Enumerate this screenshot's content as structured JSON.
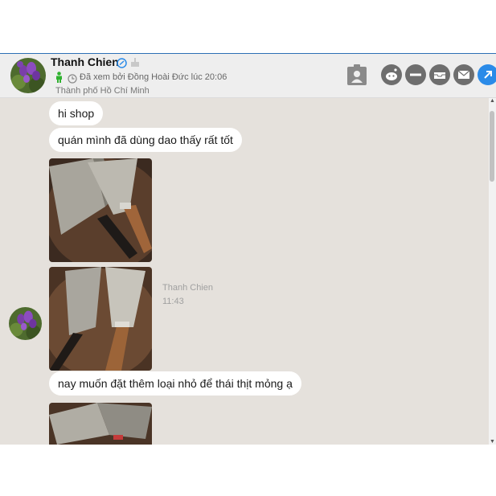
{
  "header": {
    "name": "Thanh Chien",
    "seen_text": "Đã xem bởi Đồng Hoài Đức lúc 20:06",
    "location": "Thành phố Hồ Chí Minh",
    "icons": [
      "verified-link-icon",
      "birthday-cake-icon",
      "person-icon",
      "clock-icon",
      "contact-card-icon",
      "reddit-icon",
      "minus-icon",
      "inbox-icon",
      "mail-icon",
      "share-arrow-icon"
    ]
  },
  "messages": [
    {
      "type": "text",
      "text": "hi shop"
    },
    {
      "type": "text",
      "text": "quán mình đã dùng dao thấy rất tốt"
    },
    {
      "type": "image",
      "alt_icon": "knife-photo"
    },
    {
      "type": "image",
      "alt_icon": "knife-photo"
    },
    {
      "type": "text",
      "text": "nay muốn đặt thêm loại nhỏ để thái thịt mỏng ạ"
    },
    {
      "type": "image",
      "alt_icon": "knife-photo"
    }
  ],
  "meta": {
    "sender": "Thanh Chien",
    "time": "11:43"
  },
  "colors": {
    "accent": "#2b8be8",
    "chat_bg": "#e5e1dc",
    "bubble": "#ffffff",
    "button": "#6e6e6e"
  }
}
